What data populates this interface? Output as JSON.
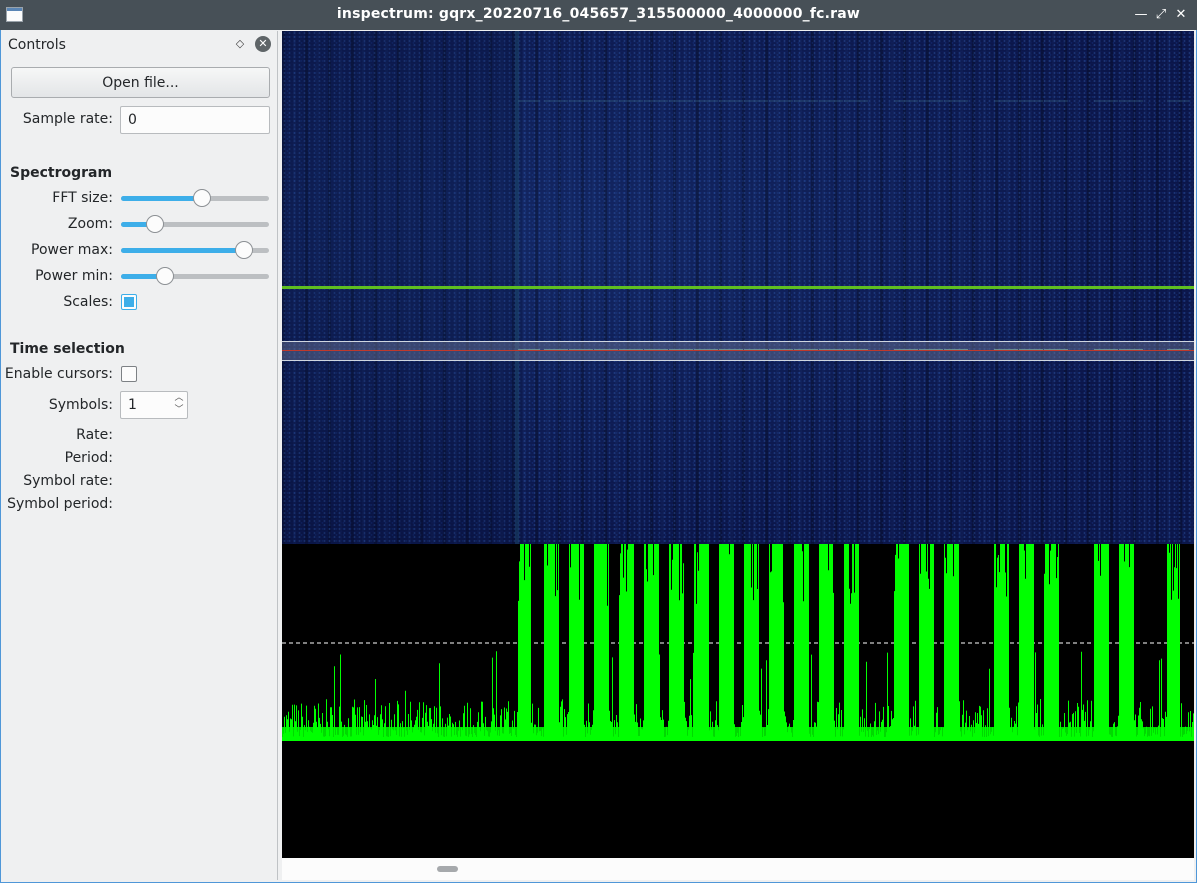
{
  "window": {
    "title": "inspectrum: gqrx_20220716_045657_315500000_4000000_fc.raw",
    "buttons": {
      "minimize": "—",
      "maximize": "⤢",
      "close": "✕"
    }
  },
  "controls": {
    "dock_title": "Controls",
    "open_file_label": "Open file...",
    "sample_rate_label": "Sample rate:",
    "sample_rate_value": "0",
    "spectrogram_heading": "Spectrogram",
    "fft_size_label": "FFT size:",
    "fft_size_level": 0.55,
    "zoom_label": "Zoom:",
    "zoom_level": 0.23,
    "power_max_label": "Power max:",
    "power_max_level": 0.83,
    "power_min_label": "Power min:",
    "power_min_level": 0.3,
    "scales_label": "Scales:",
    "scales_checked": true,
    "time_selection_heading": "Time selection",
    "enable_cursors_label": "Enable cursors:",
    "enable_cursors_checked": false,
    "symbols_label": "Symbols:",
    "symbols_value": "1",
    "rate_label": "Rate:",
    "period_label": "Period:",
    "symbol_rate_label": "Symbol rate:",
    "symbol_period_label": "Symbol period:"
  },
  "colors": {
    "accent": "#3daee9",
    "titlebar": "#475057",
    "spectrogram_bg": "#0d1a4f",
    "trace_green": "#00ff00",
    "marker_green": "#5fbf20",
    "tune_line_red": "#c0392b"
  },
  "icons": {
    "app": "window-icon",
    "float": "float-diamond-icon",
    "close": "close-circle-icon"
  }
}
